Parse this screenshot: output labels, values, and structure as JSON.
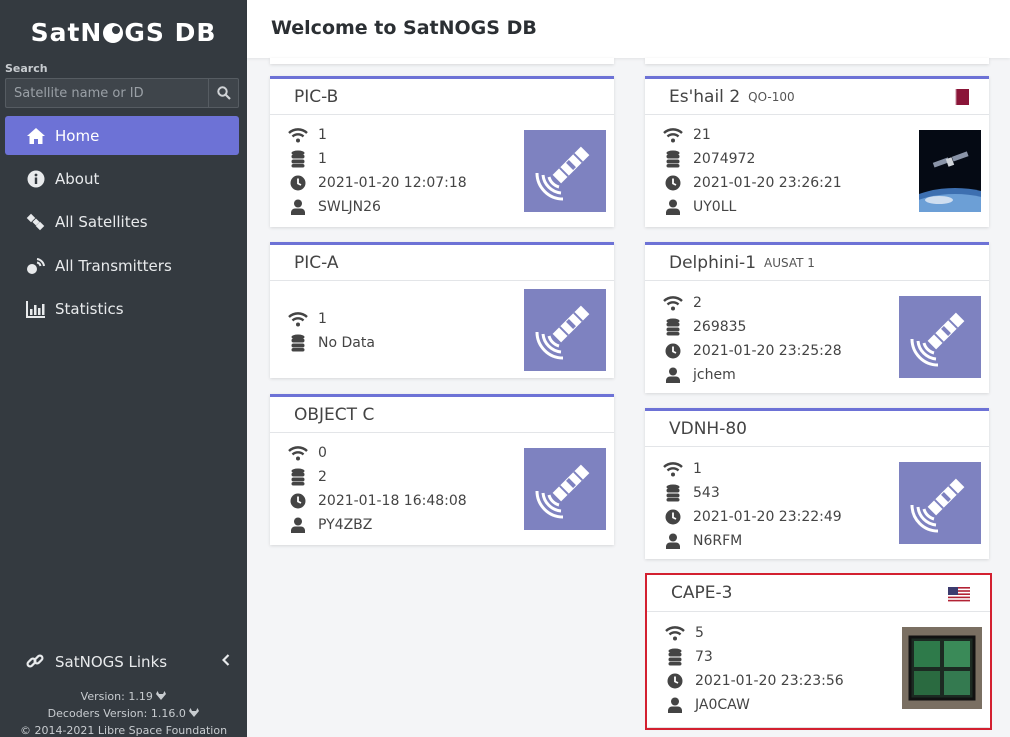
{
  "sidebar": {
    "brand": {
      "part1": "SatN",
      "part2": "GS DB"
    },
    "search": {
      "label": "Search",
      "placeholder": "Satellite name or ID"
    },
    "nav": [
      {
        "label": "Home",
        "icon": "home-icon",
        "active": true
      },
      {
        "label": "About",
        "icon": "info-icon"
      },
      {
        "label": "All Satellites",
        "icon": "satellite-icon"
      },
      {
        "label": "All Transmitters",
        "icon": "transmitter-icon"
      },
      {
        "label": "Statistics",
        "icon": "chart-icon"
      }
    ],
    "links_label": "SatNOGS Links",
    "version": "Version: 1.19",
    "decoders_version": "Decoders Version: 1.16.0",
    "copyright": "© 2014-2021 Libre Space Foundation"
  },
  "header": {
    "title": "Welcome to SatNOGS DB"
  },
  "colors": {
    "accent": "#6d72d6",
    "sidebar": "#343a40",
    "thumb": "#7e82c0",
    "highlight": "#d32030"
  },
  "cards": [
    {
      "name": "PIC-B",
      "alt": "",
      "transmitters": "1",
      "frames": "1",
      "last": "2021-01-20 12:07:18",
      "user": "SWLJN26"
    },
    {
      "name": "PIC-A",
      "alt": "",
      "transmitters": "1",
      "frames": "No Data"
    },
    {
      "name": "OBJECT C",
      "alt": "",
      "transmitters": "0",
      "frames": "2",
      "last": "2021-01-18 16:48:08",
      "user": "PY4ZBZ"
    },
    {
      "name": "Es'hail 2",
      "alt": "QO-100",
      "flag": "qatar-flag",
      "transmitters": "21",
      "frames": "2074972",
      "last": "2021-01-20 23:26:21",
      "user": "UY0LL"
    },
    {
      "name": "Delphini-1",
      "alt": "AUSAT 1",
      "transmitters": "2",
      "frames": "269835",
      "last": "2021-01-20 23:25:28",
      "user": "jchem"
    },
    {
      "name": "VDNH-80",
      "alt": "",
      "transmitters": "1",
      "frames": "543",
      "last": "2021-01-20 23:22:49",
      "user": "N6RFM"
    },
    {
      "name": "CAPE-3",
      "alt": "",
      "flag": "usa-flag",
      "transmitters": "5",
      "frames": "73",
      "last": "2021-01-20 23:23:56",
      "user": "JA0CAW"
    }
  ]
}
